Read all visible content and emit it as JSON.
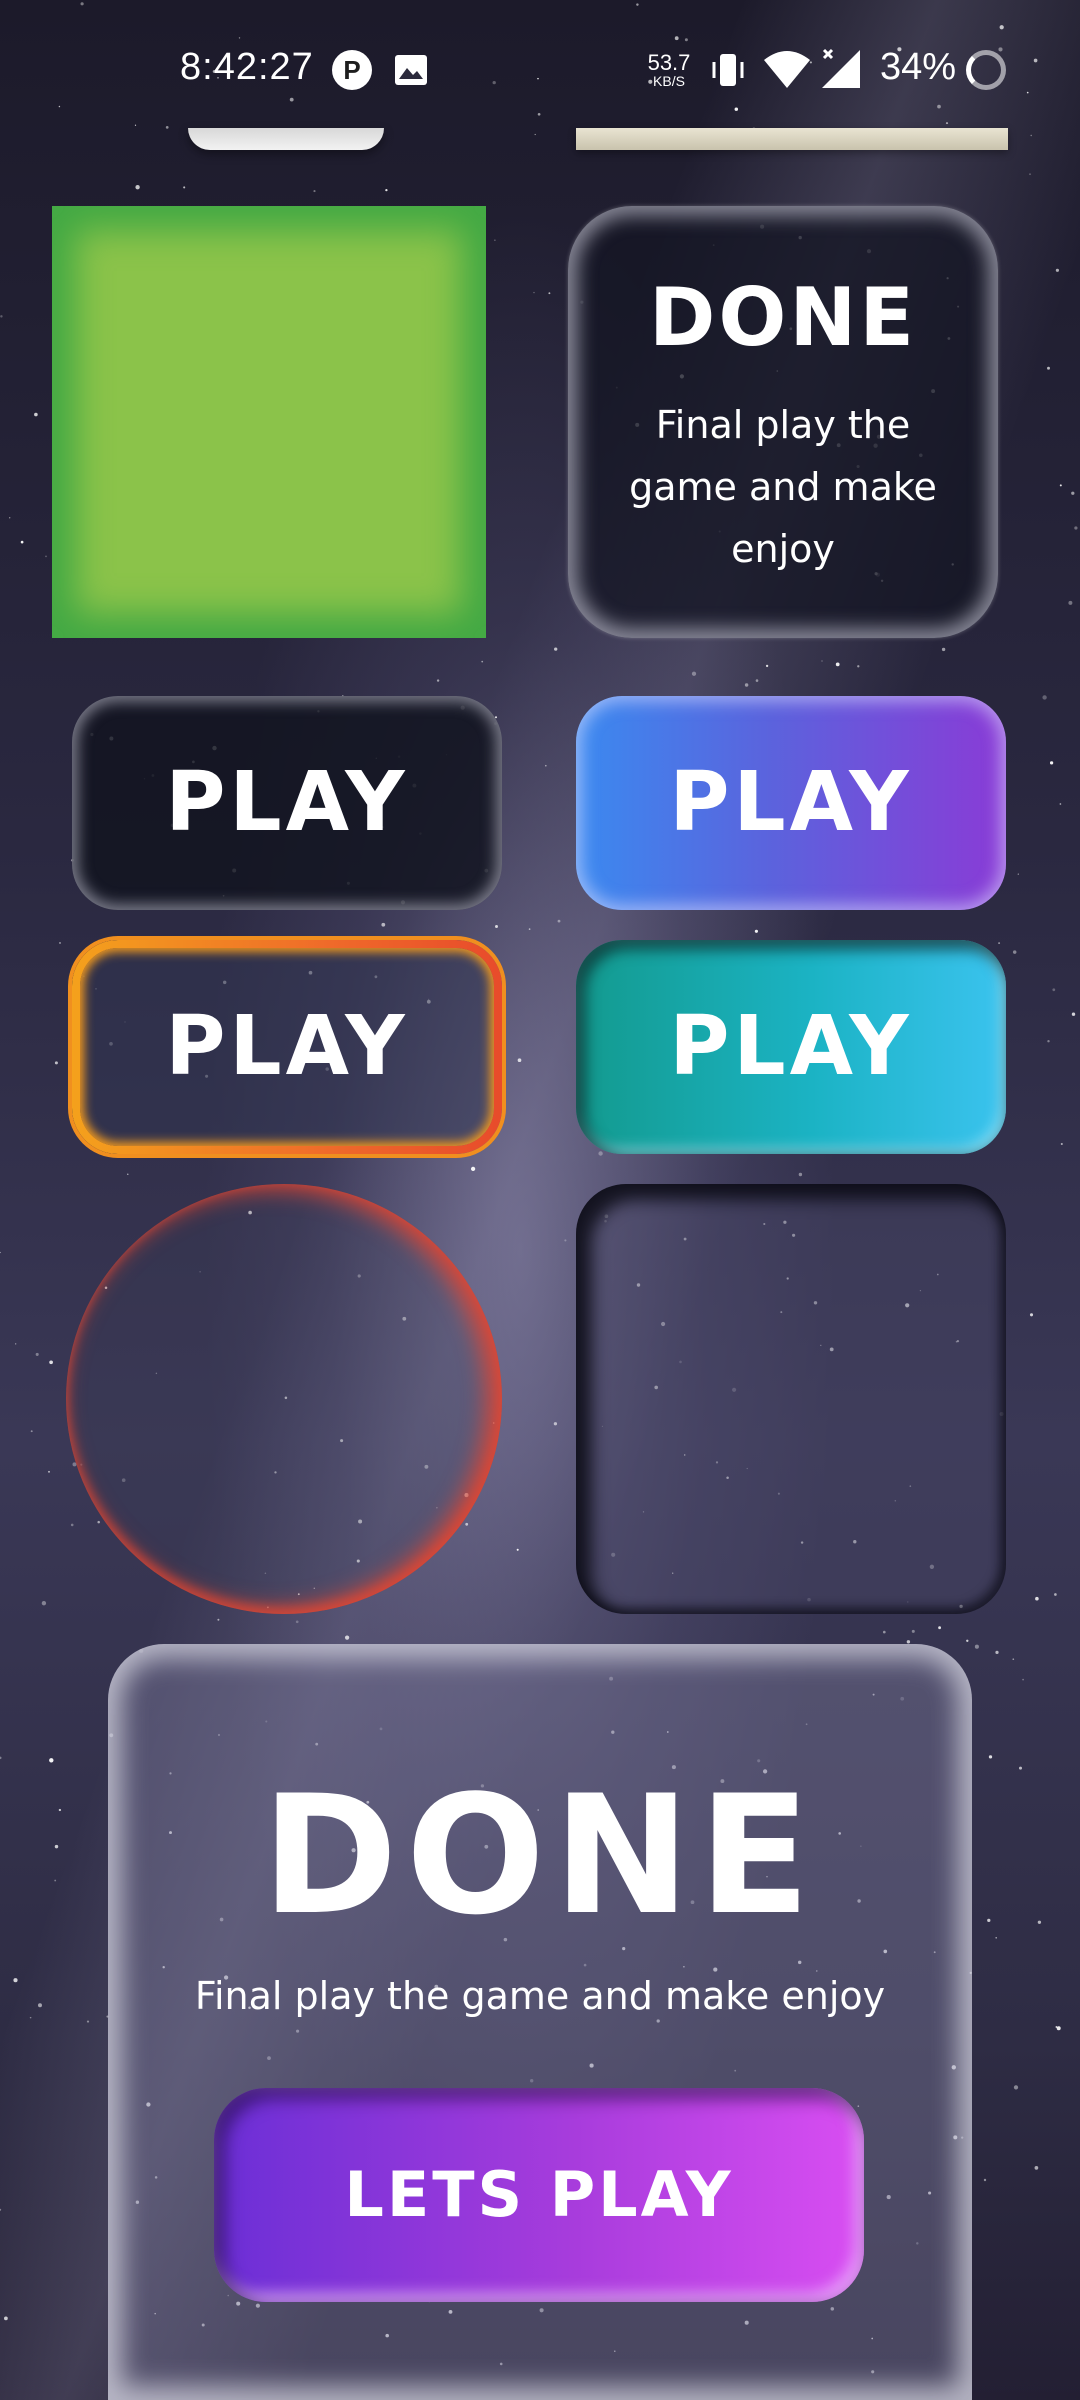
{
  "status_bar": {
    "time": "8:42:27",
    "app_icon_glyph": "P",
    "net_speed_value": "53.7",
    "net_speed_unit": "KB/S",
    "battery": "34%",
    "icons": [
      "app-notification-icon",
      "gallery-icon",
      "vibrate-icon",
      "wifi-icon",
      "cell-signal-icon",
      "battery-ring-icon"
    ]
  },
  "top_card": {
    "title": "DONE",
    "description": "Final play the game and make enjoy"
  },
  "buttons": {
    "play_dark": "PLAY",
    "play_purple": "PLAY",
    "play_orange": "PLAY",
    "play_teal": "PLAY"
  },
  "bottom_card": {
    "title": "DONE",
    "description": "Final play the game and make enjoy",
    "cta": "LETS PLAY"
  },
  "colors": {
    "green_square": "#8bc34a",
    "green_square_border": "#43a944",
    "purple_gradient": [
      "#3b8af0",
      "#8a3bd6"
    ],
    "orange_gradient": [
      "#f4a11c",
      "#e84b2b"
    ],
    "teal_gradient": [
      "#139a8e",
      "#3bc3ef"
    ],
    "lets_play_gradient": [
      "#6b2fd6",
      "#d94ef2"
    ],
    "ring_red": "#e24632"
  }
}
